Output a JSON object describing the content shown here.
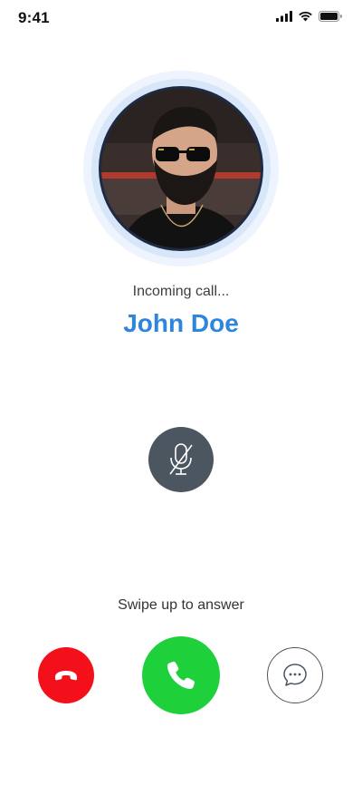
{
  "status_bar": {
    "time": "9:41",
    "icons": [
      "cellular-signal-icon",
      "wifi-icon",
      "battery-icon"
    ]
  },
  "call": {
    "status_text": "Incoming call...",
    "caller_name": "John Doe",
    "avatar_icon": "caller-avatar-photo"
  },
  "controls": {
    "mute_icon": "microphone-off-icon",
    "swipe_hint": "Swipe up to answer",
    "decline_icon": "phone-hangup-icon",
    "answer_icon": "phone-icon",
    "message_icon": "chat-bubble-icon"
  },
  "colors": {
    "accent_blue": "#2d86dc",
    "decline_red": "#f4101b",
    "answer_green": "#1ed13b",
    "mute_gray": "#4b5661"
  }
}
